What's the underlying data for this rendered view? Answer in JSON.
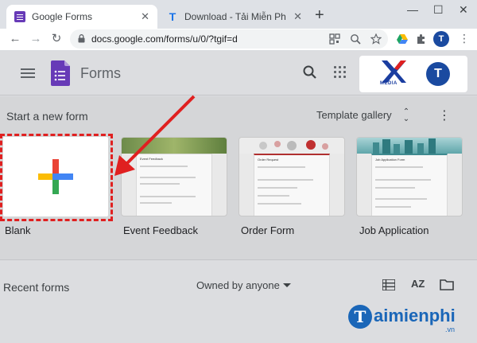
{
  "browser": {
    "tabs": [
      {
        "title": "Google Forms",
        "active": true,
        "favicon": "google-forms-favicon"
      },
      {
        "title": "Download - Tải Miễn Phí VN - Ph",
        "active": false,
        "favicon": "taimienphi-favicon"
      }
    ],
    "tab_close_glyph": "✕",
    "new_tab_glyph": "+",
    "window_controls": {
      "minimize": "—",
      "maximize": "☐",
      "close": "✕"
    },
    "nav": {
      "back": "←",
      "forward": "→",
      "reload": "↻"
    },
    "url": "docs.google.com/forms/u/0/?tgif=d",
    "profile_initial": "T",
    "menu_glyph": "⋮"
  },
  "header": {
    "title": "Forms",
    "brand_text": "MEDIA",
    "profile_initial": "T",
    "colors": {
      "forms_purple": "#673ab7",
      "profile_blue": "#1a4aa0"
    }
  },
  "start": {
    "title": "Start a new form",
    "gallery_label": "Template gallery",
    "gallery_arrows": "⌃⌄",
    "menu_glyph": "⋮",
    "templates": [
      {
        "label": "Blank"
      },
      {
        "label": "Event Feedback",
        "heading": "Event Feedback"
      },
      {
        "label": "Order Form",
        "heading": "Order Request"
      },
      {
        "label": "Job Application",
        "heading": "Job Application Form"
      }
    ]
  },
  "recent": {
    "title": "Recent forms",
    "owner_filter": "Owned by anyone",
    "sort_label": "AZ"
  },
  "watermark": {
    "letter": "T",
    "name": "aimienphi",
    "suffix": ".vn",
    "color": "#1a66b8"
  }
}
